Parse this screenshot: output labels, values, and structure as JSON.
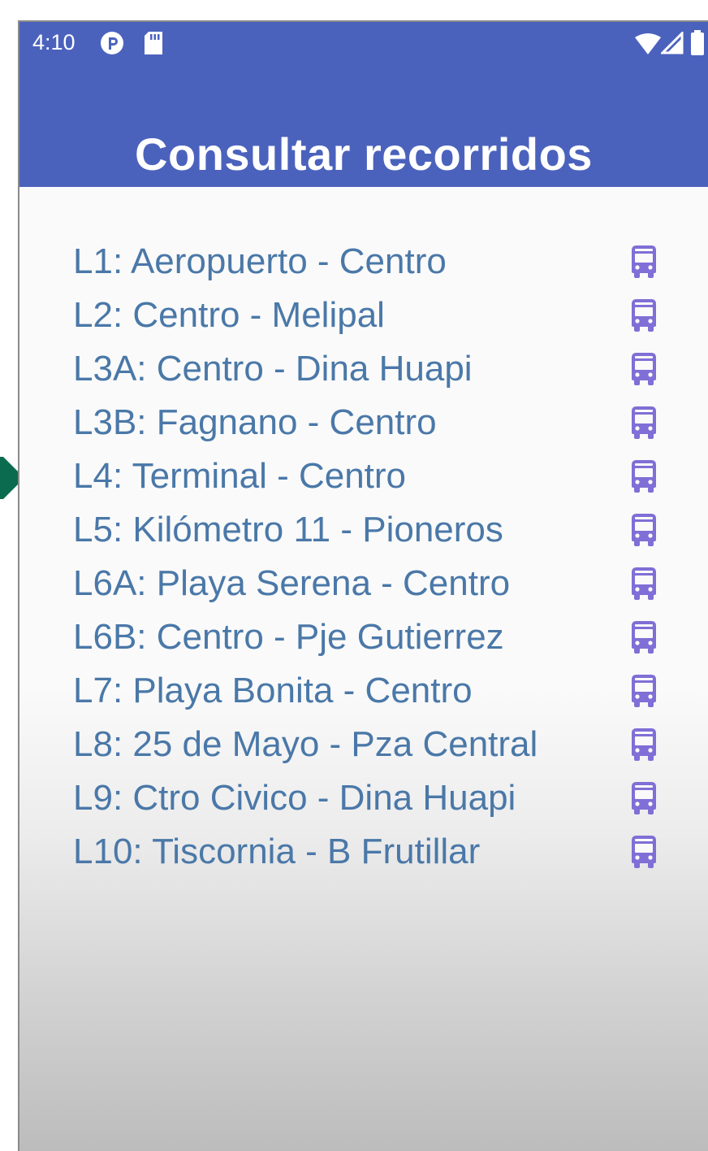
{
  "status_bar": {
    "time": "4:10"
  },
  "header": {
    "title": "Consultar recorridos"
  },
  "routes": [
    {
      "label": "L1: Aeropuerto - Centro",
      "icon": "bus-icon"
    },
    {
      "label": "L2: Centro - Melipal",
      "icon": "bus-icon"
    },
    {
      "label": "L3A: Centro - Dina Huapi",
      "icon": "bus-icon"
    },
    {
      "label": "L3B: Fagnano - Centro",
      "icon": "bus-icon"
    },
    {
      "label": "L4: Terminal - Centro",
      "icon": "bus-icon"
    },
    {
      "label": "L5: Kilómetro 11 - Pioneros",
      "icon": "bus-icon"
    },
    {
      "label": "L6A: Playa Serena - Centro",
      "icon": "bus-icon"
    },
    {
      "label": "L6B: Centro - Pje Gutierrez",
      "icon": "bus-icon"
    },
    {
      "label": "L7: Playa Bonita - Centro",
      "icon": "bus-icon"
    },
    {
      "label": "L8: 25 de Mayo - Pza Central",
      "icon": "bus-icon"
    },
    {
      "label": "L9: Ctro Civico - Dina Huapi",
      "icon": "bus-icon"
    },
    {
      "label": "L10: Tiscornia - B Frutillar",
      "icon": "bus-icon"
    }
  ],
  "colors": {
    "app_bar": "#4b62bd",
    "route_text": "#4a78a8",
    "bus_icon": "#7f6fd6",
    "annotation_green": "#0b6b4f"
  }
}
